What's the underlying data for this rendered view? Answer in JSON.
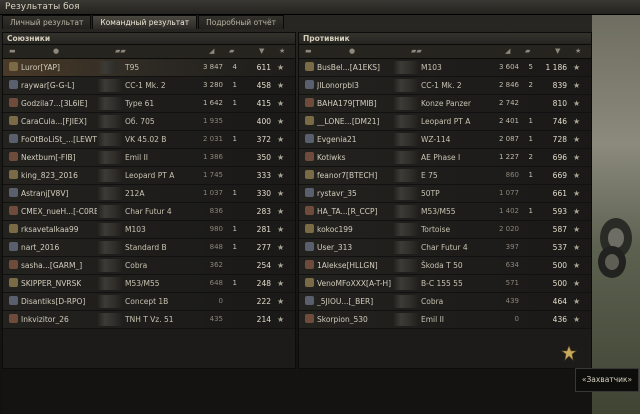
{
  "window": {
    "title": "Результаты боя"
  },
  "tabs": [
    {
      "label": "Личный результат"
    },
    {
      "label": "Командный результат"
    },
    {
      "label": "Подробный отчёт"
    }
  ],
  "allies": {
    "title": "Союзники",
    "rows": [
      {
        "name": "Luror[YAP]",
        "tank": "T95",
        "damage": "3 847",
        "kills": "4",
        "xp": "611",
        "hl": true
      },
      {
        "name": "raywar[G-G-L]",
        "tank": "CC-1 Mk. 2",
        "damage": "3 280",
        "kills": "1",
        "xp": "458"
      },
      {
        "name": "Godzila7...[3L6IE]",
        "tank": "Type 61",
        "damage": "1 642",
        "kills": "1",
        "xp": "415"
      },
      {
        "name": "CaraCula...[FJIEX]",
        "tank": "Об. 705",
        "damage": "1 935",
        "kills": "",
        "xp": "400"
      },
      {
        "name": "FoOtBoLiSt_...[LEWT]",
        "tank": "VK 45.02 B",
        "damage": "2 031",
        "kills": "1",
        "xp": "372"
      },
      {
        "name": "Nextbum[-FIB]",
        "tank": "Emil II",
        "damage": "1 386",
        "kills": "",
        "xp": "350"
      },
      {
        "name": "king_823_2016",
        "tank": "Leopard PT A",
        "damage": "1 745",
        "kills": "",
        "xp": "333"
      },
      {
        "name": "Astranj[V8V]",
        "tank": "212A",
        "damage": "1 037",
        "kills": "1",
        "xp": "330"
      },
      {
        "name": "CMEX_nueH...[-C0RE]",
        "tank": "Char Futur 4",
        "damage": "836",
        "kills": "",
        "xp": "283"
      },
      {
        "name": "rksavetalkaa99",
        "tank": "M103",
        "damage": "980",
        "kills": "1",
        "xp": "281"
      },
      {
        "name": "nart_2016",
        "tank": "Standard B",
        "damage": "848",
        "kills": "1",
        "xp": "277"
      },
      {
        "name": "sasha...[GARM_]",
        "tank": "Cobra",
        "damage": "362",
        "kills": "",
        "xp": "254"
      },
      {
        "name": "SKIPPER_NVRSK",
        "tank": "M53/M55",
        "damage": "648",
        "kills": "1",
        "xp": "248"
      },
      {
        "name": "Disantiks[D-RPO]",
        "tank": "Concept 1B",
        "damage": "0",
        "kills": "",
        "xp": "222"
      },
      {
        "name": "Inkvizitor_26",
        "tank": "TNH T Vz. 51",
        "damage": "435",
        "kills": "",
        "xp": "214"
      }
    ]
  },
  "enemies": {
    "title": "Противник",
    "rows": [
      {
        "name": "BusBel...[A1EKS]",
        "tank": "M103",
        "damage": "3 604",
        "kills": "5",
        "xp": "1 186"
      },
      {
        "name": "JILonorpbl3",
        "tank": "CC-1 Mk. 2",
        "damage": "2 846",
        "kills": "2",
        "xp": "839"
      },
      {
        "name": "BAHA179[TMIB]",
        "tank": "Konze Panzer",
        "damage": "2 742",
        "kills": "",
        "xp": "810"
      },
      {
        "name": "__LONE...[DM21]",
        "tank": "Leopard PT A",
        "damage": "2 401",
        "kills": "1",
        "xp": "746"
      },
      {
        "name": "Evgenia21",
        "tank": "WZ-114",
        "damage": "2 087",
        "kills": "1",
        "xp": "728"
      },
      {
        "name": "Kotiwks",
        "tank": "AE Phase I",
        "damage": "1 227",
        "kills": "2",
        "xp": "696"
      },
      {
        "name": "feanor7[BTECH]",
        "tank": "E 75",
        "damage": "860",
        "kills": "1",
        "xp": "669"
      },
      {
        "name": "rystavr_35",
        "tank": "50TP",
        "damage": "1 077",
        "kills": "",
        "xp": "661"
      },
      {
        "name": "HA_TA...[R_CCP]",
        "tank": "M53/M55",
        "damage": "1 402",
        "kills": "1",
        "xp": "593"
      },
      {
        "name": "kokoc199",
        "tank": "Tortoise",
        "damage": "2 020",
        "kills": "",
        "xp": "587"
      },
      {
        "name": "User_313",
        "tank": "Char Futur 4",
        "damage": "397",
        "kills": "",
        "xp": "537"
      },
      {
        "name": "1Alekse[HLLGN]",
        "tank": "Škoda T 50",
        "damage": "634",
        "kills": "",
        "xp": "500"
      },
      {
        "name": "VenoMFoXXX[A-T-H]",
        "tank": "B-C 155 55",
        "damage": "571",
        "kills": "",
        "xp": "500"
      },
      {
        "name": "_5JIOU...[_BER]",
        "tank": "Cobra",
        "damage": "439",
        "kills": "",
        "xp": "464"
      },
      {
        "name": "Skorpion_530",
        "tank": "Emil II",
        "damage": "0",
        "kills": "",
        "xp": "436"
      }
    ]
  },
  "tooltip": {
    "text": "«Захватчик»"
  },
  "colors": {
    "accent": "#e3c27a",
    "highlight": "#4a3a28"
  }
}
